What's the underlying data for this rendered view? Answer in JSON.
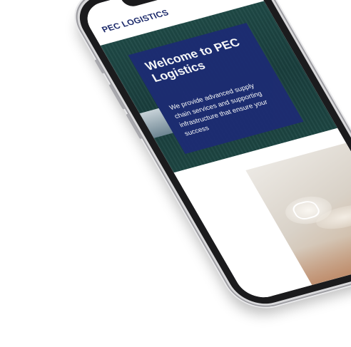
{
  "site": {
    "logo_text": "PEC LOGISTICS",
    "menu_icon": "hamburger-menu-icon"
  },
  "hero": {
    "title": "Welcome to PEC Logistics",
    "text": "We provide advanced supply chain services and supporting infrastructure that ensure your success"
  },
  "colors": {
    "brand_navy": "#1d2c73",
    "hero_green": "#1f4a47",
    "phone_frame": "#1b1b1d"
  }
}
